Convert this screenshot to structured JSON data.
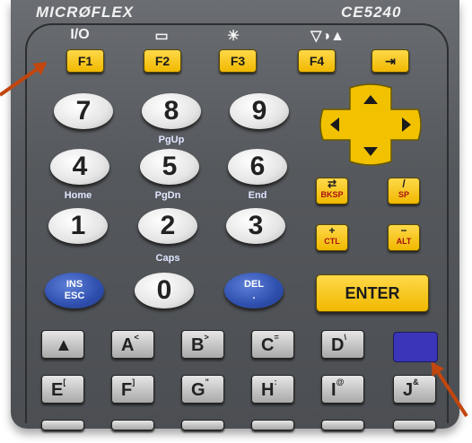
{
  "brand": "MICRØFLEX",
  "model": "CE5240",
  "top_labels": [
    "I/O",
    "▭",
    "☀",
    "▽◑▲"
  ],
  "fkeys": [
    "F1",
    "F2",
    "F3",
    "F4",
    "⇥"
  ],
  "numbers": [
    "7",
    "8",
    "9",
    "4",
    "5",
    "6",
    "1",
    "2",
    "3",
    "0"
  ],
  "sub_labels": {
    "pgup": "PgUp",
    "home": "Home",
    "pgdn": "PgDn",
    "end": "End",
    "caps": "Caps"
  },
  "blue_keys": {
    "ins": "INS",
    "esc": "ESC",
    "del": "DEL",
    "dot": "."
  },
  "yellow_small": {
    "bksp": "BKSP",
    "sp": "SP",
    "ctl": "CTL",
    "alt": "ALT"
  },
  "enter": "ENTER",
  "alpha": [
    {
      "k": "A",
      "s": "<"
    },
    {
      "k": "B",
      "s": ">"
    },
    {
      "k": "C",
      "s": "="
    },
    {
      "k": "D",
      "s": "\\"
    },
    {
      "k": "E",
      "s": "["
    },
    {
      "k": "F",
      "s": "]"
    },
    {
      "k": "G",
      "s": "\""
    },
    {
      "k": "H",
      "s": ":"
    },
    {
      "k": "I",
      "s": "@"
    },
    {
      "k": "J",
      "s": "&"
    }
  ],
  "colors": {
    "case": "#55585c",
    "yellow": "#f0b800",
    "blue": "#2f4fae",
    "arrow": "#c2460e"
  }
}
